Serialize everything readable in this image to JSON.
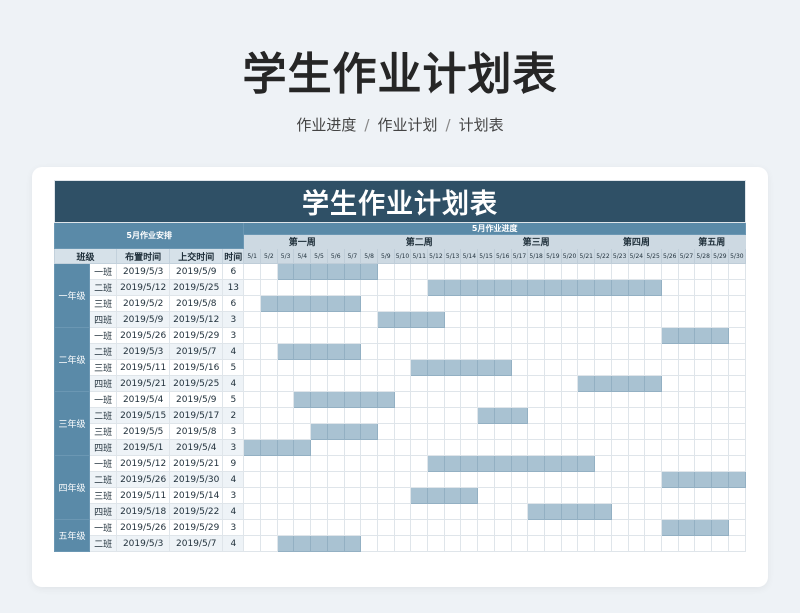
{
  "page": {
    "title": "学生作业计划表",
    "breadcrumb": [
      "作业进度",
      "作业计划",
      "计划表"
    ],
    "breadcrumb_sep": "/"
  },
  "sheet": {
    "title": "学生作业计划表",
    "left_group": "5月作业安排",
    "right_group": "5月作业进度",
    "col_headers": {
      "grade": "班级",
      "assign": "布置时间",
      "due": "上交时间",
      "duration": "时间"
    },
    "weeks": [
      {
        "label": "第一周",
        "span": 7
      },
      {
        "label": "第二周",
        "span": 7
      },
      {
        "label": "第三周",
        "span": 7
      },
      {
        "label": "第四周",
        "span": 5
      },
      {
        "label": "第五周",
        "span": 4
      }
    ],
    "days": [
      "5/1",
      "5/2",
      "5/3",
      "5/4",
      "5/5",
      "5/6",
      "5/7",
      "5/8",
      "5/9",
      "5/10",
      "5/11",
      "5/12",
      "5/13",
      "5/14",
      "5/15",
      "5/16",
      "5/17",
      "5/18",
      "5/19",
      "5/20",
      "5/21",
      "5/22",
      "5/23",
      "5/24",
      "5/25",
      "5/26",
      "5/27",
      "5/28",
      "5/29",
      "5/30"
    ],
    "grades": [
      {
        "name": "一年级",
        "rows": [
          {
            "cls": "一班",
            "assign": "2019/5/3",
            "due": "2019/5/9",
            "duration": "6",
            "start": 3,
            "end": 8
          },
          {
            "cls": "二班",
            "assign": "2019/5/12",
            "due": "2019/5/25",
            "duration": "13",
            "start": 12,
            "end": 25
          },
          {
            "cls": "三班",
            "assign": "2019/5/2",
            "due": "2019/5/8",
            "duration": "6",
            "start": 2,
            "end": 7
          },
          {
            "cls": "四班",
            "assign": "2019/5/9",
            "due": "2019/5/12",
            "duration": "3",
            "start": 9,
            "end": 12
          }
        ]
      },
      {
        "name": "二年级",
        "rows": [
          {
            "cls": "一班",
            "assign": "2019/5/26",
            "due": "2019/5/29",
            "duration": "3",
            "start": 26,
            "end": 29
          },
          {
            "cls": "二班",
            "assign": "2019/5/3",
            "due": "2019/5/7",
            "duration": "4",
            "start": 3,
            "end": 7
          },
          {
            "cls": "三班",
            "assign": "2019/5/11",
            "due": "2019/5/16",
            "duration": "5",
            "start": 11,
            "end": 16
          },
          {
            "cls": "四班",
            "assign": "2019/5/21",
            "due": "2019/5/25",
            "duration": "4",
            "start": 21,
            "end": 25
          }
        ]
      },
      {
        "name": "三年级",
        "rows": [
          {
            "cls": "一班",
            "assign": "2019/5/4",
            "due": "2019/5/9",
            "duration": "5",
            "start": 4,
            "end": 9
          },
          {
            "cls": "二班",
            "assign": "2019/5/15",
            "due": "2019/5/17",
            "duration": "2",
            "start": 15,
            "end": 17
          },
          {
            "cls": "三班",
            "assign": "2019/5/5",
            "due": "2019/5/8",
            "duration": "3",
            "start": 5,
            "end": 8
          },
          {
            "cls": "四班",
            "assign": "2019/5/1",
            "due": "2019/5/4",
            "duration": "3",
            "start": 1,
            "end": 4
          }
        ]
      },
      {
        "name": "四年级",
        "rows": [
          {
            "cls": "一班",
            "assign": "2019/5/12",
            "due": "2019/5/21",
            "duration": "9",
            "start": 12,
            "end": 21
          },
          {
            "cls": "二班",
            "assign": "2019/5/26",
            "due": "2019/5/30",
            "duration": "4",
            "start": 26,
            "end": 30
          },
          {
            "cls": "三班",
            "assign": "2019/5/11",
            "due": "2019/5/14",
            "duration": "3",
            "start": 11,
            "end": 14
          },
          {
            "cls": "四班",
            "assign": "2019/5/18",
            "due": "2019/5/22",
            "duration": "4",
            "start": 18,
            "end": 22
          }
        ]
      },
      {
        "name": "五年级",
        "rows": [
          {
            "cls": "一班",
            "assign": "2019/5/26",
            "due": "2019/5/29",
            "duration": "3",
            "start": 26,
            "end": 29
          },
          {
            "cls": "二班",
            "assign": "2019/5/3",
            "due": "2019/5/7",
            "duration": "4",
            "start": 3,
            "end": 7
          }
        ]
      }
    ]
  }
}
